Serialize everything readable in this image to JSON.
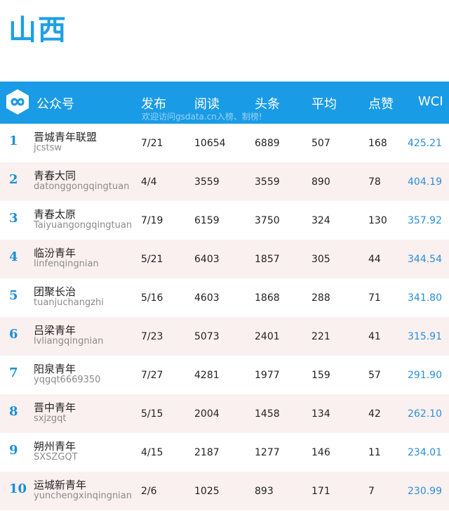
{
  "title": "山西",
  "header": {
    "account": "公众号",
    "publish": "发布",
    "reads": "阅读",
    "headline": "头条",
    "average": "平均",
    "likes": "点赞",
    "wci": "WCI",
    "watermark": "欢迎访问gsdata.cn入榜、制榜!"
  },
  "rows": [
    {
      "rank": "1",
      "name": "晋城青年联盟",
      "account": "jcstsw",
      "publish": "7/21",
      "reads": "10654",
      "headline": "6889",
      "average": "507",
      "likes": "168",
      "wci": "425.21"
    },
    {
      "rank": "2",
      "name": "青春大同",
      "account": "datonggongqingtuan",
      "publish": "4/4",
      "reads": "3559",
      "headline": "3559",
      "average": "890",
      "likes": "78",
      "wci": "404.19"
    },
    {
      "rank": "3",
      "name": "青春太原",
      "account": "Taiyuangongqingtuan",
      "publish": "7/19",
      "reads": "6159",
      "headline": "3750",
      "average": "324",
      "likes": "130",
      "wci": "357.92"
    },
    {
      "rank": "4",
      "name": "临汾青年",
      "account": "linfenqingnian",
      "publish": "5/21",
      "reads": "6403",
      "headline": "1857",
      "average": "305",
      "likes": "44",
      "wci": "344.54"
    },
    {
      "rank": "5",
      "name": "团聚长治",
      "account": "tuanjuchangzhi",
      "publish": "5/16",
      "reads": "4603",
      "headline": "1868",
      "average": "288",
      "likes": "71",
      "wci": "341.80"
    },
    {
      "rank": "6",
      "name": "吕梁青年",
      "account": "lvliangqingnian",
      "publish": "7/23",
      "reads": "5073",
      "headline": "2401",
      "average": "221",
      "likes": "41",
      "wci": "315.91"
    },
    {
      "rank": "7",
      "name": "阳泉青年",
      "account": "yqgqt6669350",
      "publish": "7/27",
      "reads": "4281",
      "headline": "1977",
      "average": "159",
      "likes": "57",
      "wci": "291.90"
    },
    {
      "rank": "8",
      "name": "晋中青年",
      "account": "sxjzgqt",
      "publish": "5/15",
      "reads": "2004",
      "headline": "1458",
      "average": "134",
      "likes": "42",
      "wci": "262.10"
    },
    {
      "rank": "9",
      "name": "朔州青年",
      "account": "SXSZGQT",
      "publish": "4/15",
      "reads": "2187",
      "headline": "1277",
      "average": "146",
      "likes": "11",
      "wci": "234.01"
    },
    {
      "rank": "10",
      "name": "运城新青年",
      "account": "yunchengxinqingnian",
      "publish": "2/6",
      "reads": "1025",
      "headline": "893",
      "average": "171",
      "likes": "7",
      "wci": "230.99"
    }
  ]
}
